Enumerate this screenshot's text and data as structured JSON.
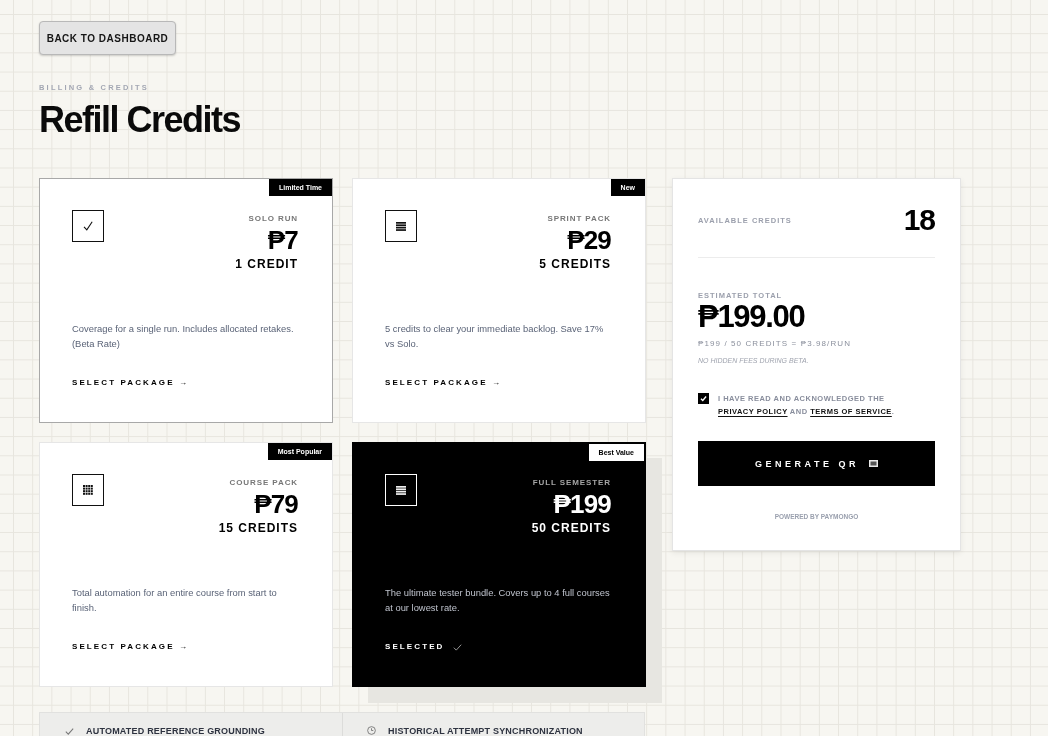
{
  "back_button": {
    "label": "BACK TO DASHBOARD"
  },
  "header": {
    "eyebrow": "BILLING & CREDITS",
    "title": "Refill Credits"
  },
  "packages": [
    {
      "badge": "Limited Time",
      "kind": "check",
      "name": "SOLO RUN",
      "price": "₱7",
      "credits": "1 CREDIT",
      "description": "Coverage for a single run. Includes allocated retakes. (Beta Rate)",
      "action": "SELECT PACKAGE →",
      "selected": false,
      "hovered": true
    },
    {
      "badge": "New",
      "kind": "rows",
      "name": "SPRINT PACK",
      "price": "₱29",
      "credits": "5 CREDITS",
      "description": "5 credits to clear your immediate backlog. Save 17% vs Solo.",
      "action": "SELECT PACKAGE →",
      "selected": false,
      "hovered": false
    },
    {
      "badge": "Most Popular",
      "kind": "grid",
      "name": "COURSE PACK",
      "price": "₱79",
      "credits": "15 CREDITS",
      "description": "Total automation for an entire course from start to finish.",
      "action": "SELECT PACKAGE →",
      "selected": false,
      "hovered": false
    },
    {
      "badge": "Best Value",
      "kind": "rows",
      "name": "FULL SEMESTER",
      "price": "₱199",
      "credits": "50 CREDITS",
      "description": "The ultimate tester bundle. Covers up to 4 full courses at our lowest rate.",
      "action": "SELECTED",
      "selected": true,
      "hovered": false
    }
  ],
  "summary": {
    "available_label": "AVAILABLE CREDITS",
    "available": "18",
    "total_label": "ESTIMATED TOTAL",
    "total": "₱199.00",
    "breakdown": "₱199 / 50 CREDITS = ₱3.98/RUN",
    "note": "NO HIDDEN FEES DURING BETA.",
    "consent": {
      "checked": true,
      "text_before": "I HAVE READ AND ACKNOWLEDGED THE",
      "privacy_link": "PRIVACY POLICY",
      "text_middle": "AND",
      "terms_link": "TERMS OF SERVICE",
      "text_after": "."
    },
    "button": "GENERATE QR",
    "footer": "POWERED BY PAYMONGO"
  },
  "features": [
    {
      "kind": "check",
      "label": "AUTOMATED REFERENCE GROUNDING"
    },
    {
      "kind": "clock",
      "label": "HISTORICAL ATTEMPT SYNCHRONIZATION"
    }
  ]
}
